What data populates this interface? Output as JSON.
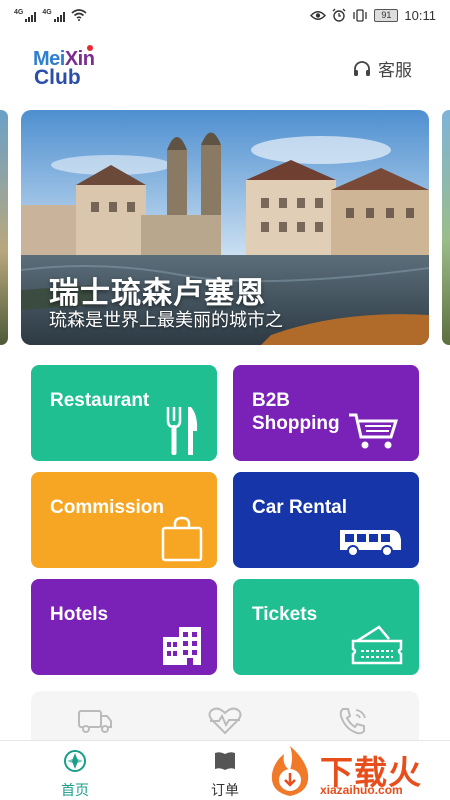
{
  "status_bar": {
    "sim1": "4G",
    "sim2": "4G",
    "battery": "91",
    "time": "10:11",
    "icons": [
      "signal-icon",
      "wifi-icon",
      "eye-icon",
      "alarm-icon",
      "vibrate-icon",
      "battery-icon"
    ]
  },
  "header": {
    "logo": {
      "line1_a": "Mei",
      "line1_b": "Xin",
      "line2": "Club"
    },
    "service_label": "客服",
    "service_icon": "headset-icon"
  },
  "banner": {
    "title": "瑞士琉森卢塞恩",
    "subtitle": "琉森是世界上最美丽的城市之"
  },
  "tiles": [
    {
      "label": "Restaurant",
      "color": "#1fbf92",
      "icon": "cutlery-icon"
    },
    {
      "label": "B2B Shopping",
      "color": "#7a22b8",
      "icon": "cart-icon"
    },
    {
      "label": "Commission",
      "color": "#f6a623",
      "icon": "shopping-bag-icon"
    },
    {
      "label": "Car Rental",
      "color": "#1535a8",
      "icon": "bus-icon"
    },
    {
      "label": "Hotels",
      "color": "#7a22b8",
      "icon": "building-icon"
    },
    {
      "label": "Tickets",
      "color": "#1fbf92",
      "icon": "ticket-icon"
    }
  ],
  "quick": [
    "truck-icon",
    "heartbeat-icon",
    "phone-icon"
  ],
  "nav": {
    "home": "首页",
    "orders": "订单",
    "active_color": "#1a9e89"
  },
  "watermark": {
    "text": "下载火",
    "url": "xiazaihuo.com"
  }
}
